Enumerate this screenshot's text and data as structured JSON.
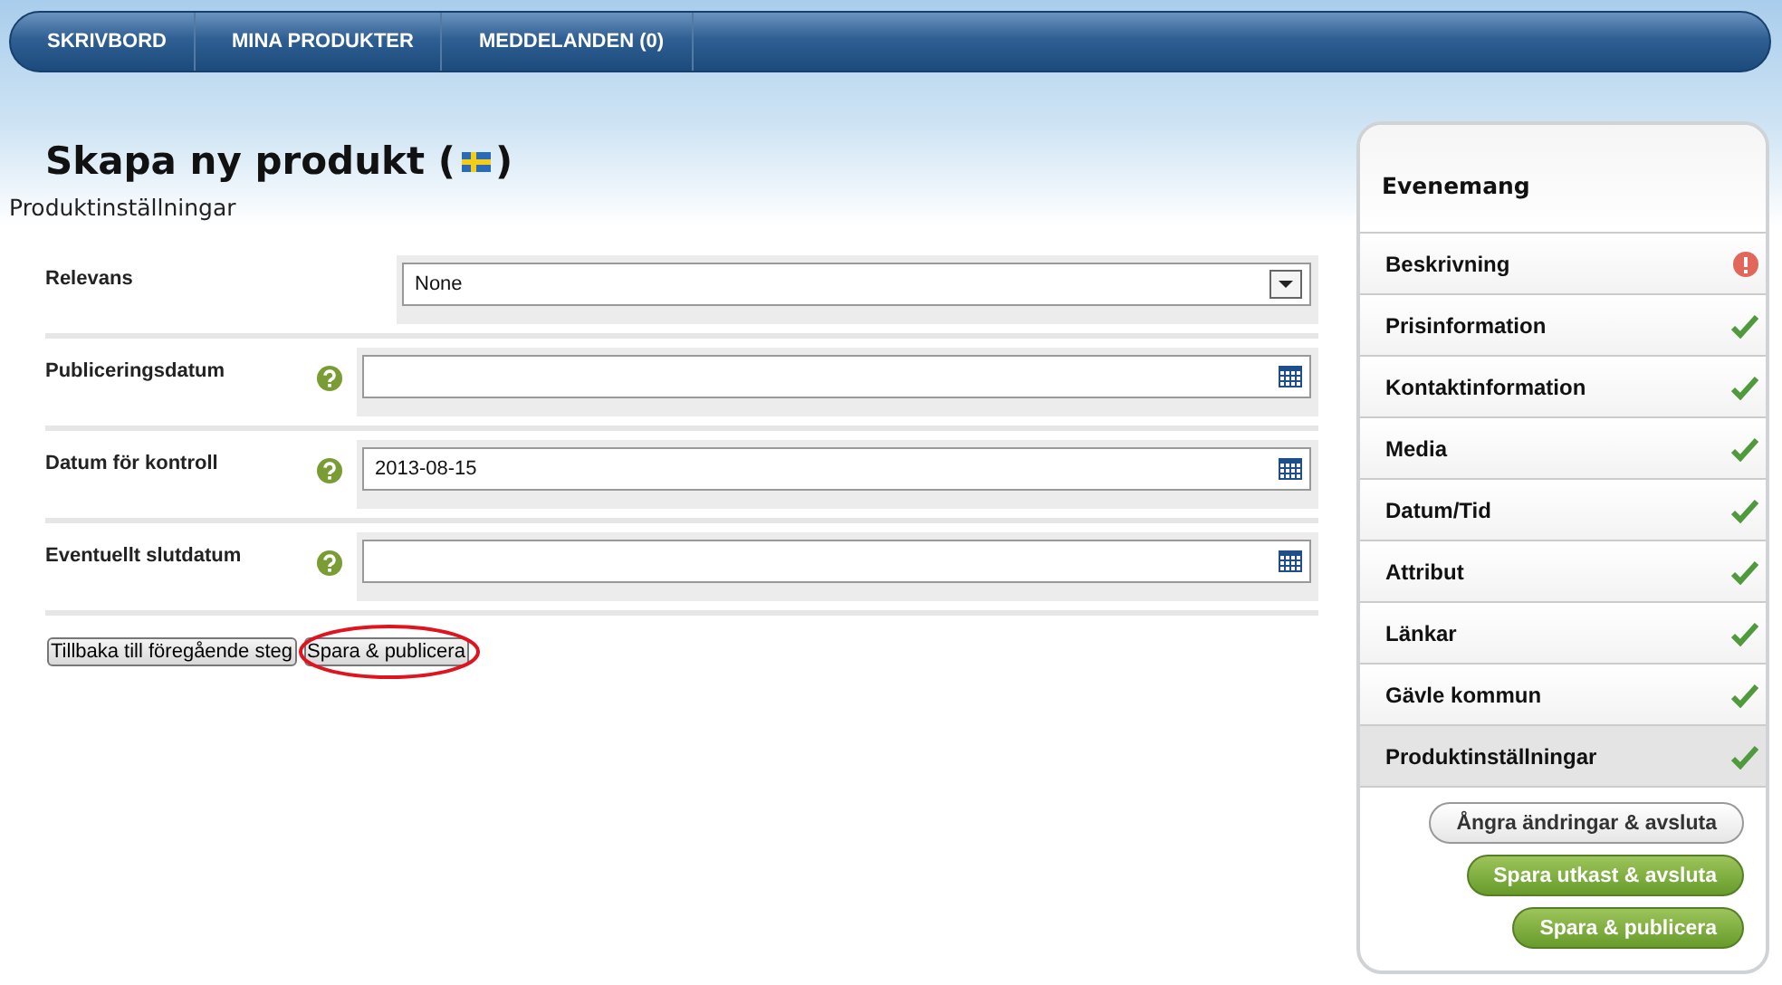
{
  "nav": {
    "items": [
      {
        "label": "SKRIVBORD"
      },
      {
        "label": "MINA PRODUKTER"
      },
      {
        "label": "MEDDELANDEN (0)"
      }
    ]
  },
  "title": "Skapa ny produkt (",
  "title_end": ")",
  "subtitle": "Produktinställningar",
  "form": {
    "fields": [
      {
        "label": "Relevans",
        "kind": "select",
        "value": "None",
        "help": false
      },
      {
        "label": "Publiceringsdatum",
        "kind": "date",
        "help": true
      },
      {
        "label": "Datum för kontroll",
        "kind": "date",
        "value": "2013-08-15",
        "help": true
      },
      {
        "label": "Eventuellt slutdatum",
        "kind": "date",
        "help": true
      }
    ],
    "buttons": [
      {
        "label": "Tillbaka till föregående steg",
        "highlighted": false
      },
      {
        "label": "Spara & publicera",
        "highlighted": true
      }
    ]
  },
  "sidebar": {
    "title": "Evenemang",
    "items": [
      {
        "label": "Beskrivning",
        "kind": "error",
        "selected": false
      },
      {
        "label": "Prisinformation",
        "kind": "done",
        "selected": false
      },
      {
        "label": "Kontaktinformation",
        "kind": "done",
        "selected": false
      },
      {
        "label": "Media",
        "kind": "done",
        "selected": false
      },
      {
        "label": "Datum/Tid",
        "kind": "done",
        "selected": false
      },
      {
        "label": "Attribut",
        "kind": "done",
        "selected": false
      },
      {
        "label": "Länkar",
        "kind": "done",
        "selected": false
      },
      {
        "label": "Gävle kommun",
        "kind": "done",
        "selected": false
      },
      {
        "label": "Produktinställningar",
        "kind": "done",
        "selected": true
      }
    ],
    "buttons": [
      {
        "label": "Ångra ändringar & avsluta",
        "kind": "plain"
      },
      {
        "label": "Spara utkast & avsluta",
        "kind": "primary"
      },
      {
        "label": "Spara & publicera",
        "kind": "primary"
      }
    ]
  }
}
